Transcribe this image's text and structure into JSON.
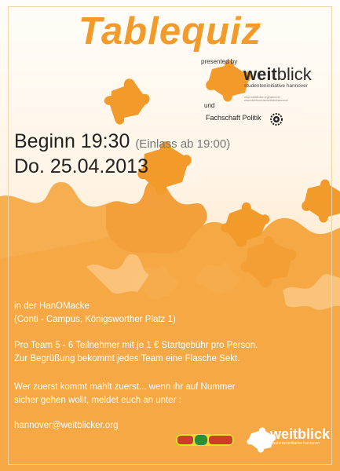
{
  "poster": {
    "title": "Tablequiz",
    "presented_by": "presented by",
    "logo": {
      "word_bold": "weit",
      "word_thin": "blick",
      "sub": "studenteninitiative hannover",
      "urls": "www.weitblicker.org/hannover www.facebook.de/weitblickhannover"
    },
    "und": "und",
    "fachschaft": "Fachschaft Politik",
    "beginn": "Beginn 19:30",
    "einlass": "(Einlass ab 19:00)",
    "date": "Do. 25.04.2013",
    "lines": {
      "l1": "in der HanOMacke",
      "l2": "(Conti - Campus, Königsworther Platz 1)",
      "l3": "Pro Team 5 - 6 Teilnehmer mit je 1 € Startgebühr pro Person.",
      "l4": "Zur Begrüßung bekommt jedes Team eine Flasche Sekt.",
      "l5": "Wer zuerst kommt mahlt zuerst... wenn ihr auf Nummer",
      "l6": "sicher gehen wollt, meldet euch an unter :",
      "l7": "hannover@weitblicker.org"
    },
    "bottom_logo": {
      "word": "weitblick",
      "sub": "studenteninitiative hannover"
    },
    "hanomacke_logo": "HanOMacke"
  },
  "colors": {
    "accent": "#f29a2a",
    "puzzle": "#f4a33a"
  }
}
